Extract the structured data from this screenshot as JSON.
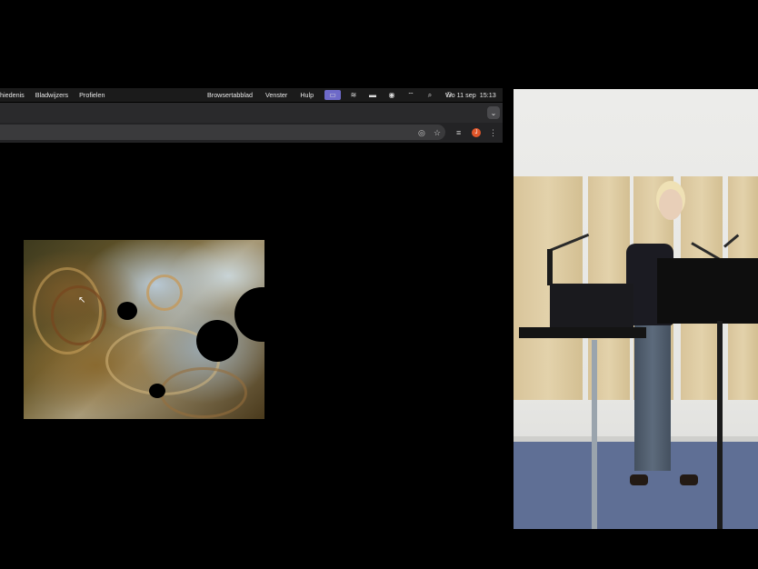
{
  "menubar": {
    "left_items": [
      "hiedenis",
      "Bladwijzers",
      "Profielen"
    ],
    "right_items": [
      "Browsertabblad",
      "Venster",
      "Hulp"
    ],
    "tray_icons": [
      "screen-share-icon",
      "stack-icon",
      "battery-icon",
      "record-icon",
      "wifi-icon",
      "search-icon",
      "control-center-icon"
    ],
    "clock_date": "Wo 11 sep",
    "clock_time": "15:13"
  },
  "tabstrip": {
    "dropdown_icon": "chevron-down-icon"
  },
  "toolbar": {
    "icons": [
      "eye-icon",
      "star-icon",
      "media-icon",
      "avatar",
      "more-icon"
    ],
    "avatar_letter": "J"
  },
  "colors": {
    "menubar_bg": "#1b1b1b",
    "active_tray": "#6e6ac9",
    "avatar": "#e0562a",
    "floor": "#5f6f95"
  }
}
